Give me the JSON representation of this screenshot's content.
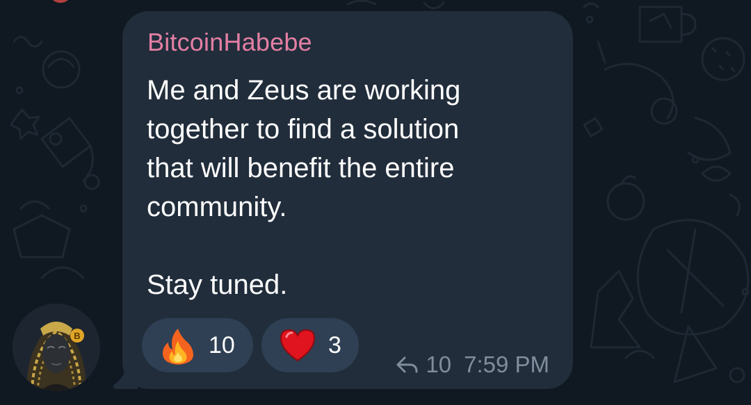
{
  "message": {
    "sender": "BitcoinHabebe",
    "text": "Me and Zeus are working\ntogether to find a solution\nthat will benefit the entire\ncommunity.\n\nStay tuned.",
    "reactions": [
      {
        "emoji": "fire-icon",
        "count": "10"
      },
      {
        "emoji": "heart-icon",
        "count": "3"
      }
    ],
    "reply_count": "10",
    "time": "7:59 PM"
  },
  "colors": {
    "background": "#101922",
    "bubble": "#212d3b",
    "sender_name": "#e47fa4",
    "reaction_pill": "#2f4054",
    "meta_text": "#7f8d9d"
  }
}
